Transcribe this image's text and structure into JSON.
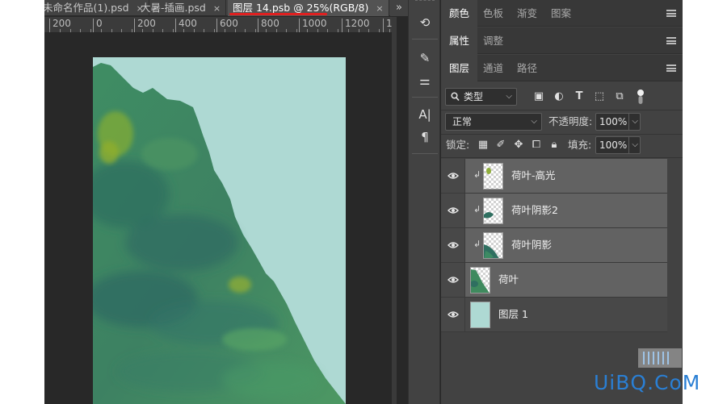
{
  "document_tabs": [
    {
      "label": "未命名作品(1).psd",
      "close": "×"
    },
    {
      "label": "大暑-插画.psd",
      "close": "×"
    },
    {
      "label": "图层 14.psb @ 25%(RGB/8)",
      "close": "×",
      "active": true
    }
  ],
  "tab_overflow": "»",
  "ruler": {
    "labels": [
      "200",
      "0",
      "200",
      "400",
      "600",
      "800",
      "1000",
      "1200",
      "1"
    ]
  },
  "tools": [
    {
      "icon": "history-brush-icon",
      "glyph": "⟲"
    },
    {
      "icon": "brush-settings-icon",
      "glyph": "✎"
    },
    {
      "icon": "adjustments-icon",
      "glyph": "⚌"
    },
    {
      "icon": "character-icon",
      "glyph": "A|"
    },
    {
      "icon": "paragraph-icon",
      "glyph": "¶"
    }
  ],
  "panel_row1": {
    "tabs": [
      "颜色",
      "色板",
      "渐变",
      "图案"
    ],
    "active": "颜色"
  },
  "panel_row2": {
    "tabs": [
      "属性",
      "调整"
    ],
    "active": "属性"
  },
  "panel_row3": {
    "tabs": [
      "图层",
      "通道",
      "路径"
    ],
    "active": "图层"
  },
  "layers_panel": {
    "filter_kind": "类型",
    "blend_mode": "正常",
    "opacity_label": "不透明度:",
    "opacity_value": "100%",
    "lock_label": "锁定:",
    "fill_label": "填充:",
    "fill_value": "100%",
    "filter_icons": [
      "image-filter-icon",
      "adjustment-filter-icon",
      "type-filter-icon",
      "shape-filter-icon",
      "smart-object-filter-icon",
      "filter-toggle-icon"
    ],
    "lock_icons": [
      "lock-transparent-icon",
      "lock-image-icon",
      "lock-position-icon",
      "lock-artboard-icon",
      "lock-all-icon"
    ]
  },
  "layers": [
    {
      "name": "荷叶-高光",
      "clipped": true,
      "selected": true,
      "thumb": "highlight"
    },
    {
      "name": "荷叶阴影2",
      "clipped": true,
      "selected": true,
      "thumb": "shadow2"
    },
    {
      "name": "荷叶阴影",
      "clipped": true,
      "selected": true,
      "thumb": "shadow"
    },
    {
      "name": "荷叶",
      "clipped": false,
      "selected": true,
      "thumb": "leaf"
    },
    {
      "name": "图层 1",
      "clipped": false,
      "selected": false,
      "thumb": "fill"
    }
  ],
  "colors": {
    "canvas_bg": "#aed9d3",
    "leaf_green": "#3f8a5e",
    "active_tab_underline": "#e02020",
    "watermark": "#2a7fd4"
  },
  "watermark": "UiBQ.CoM"
}
